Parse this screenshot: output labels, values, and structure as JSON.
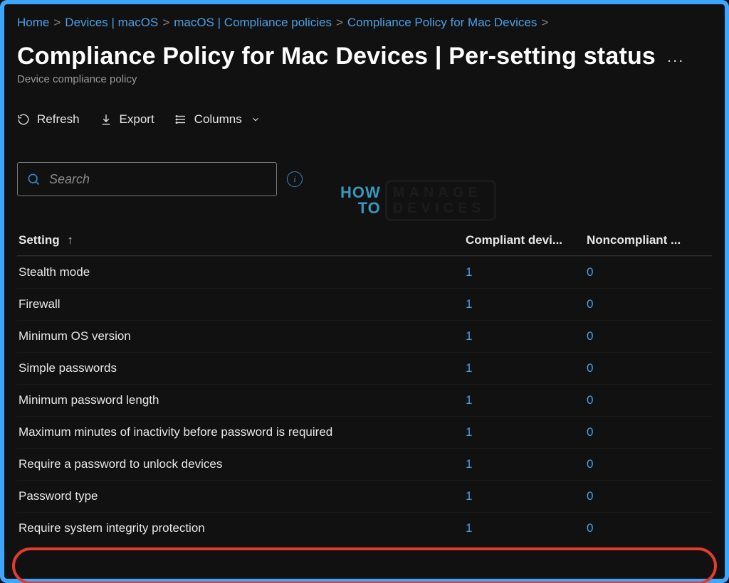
{
  "breadcrumb": {
    "items": [
      {
        "label": "Home"
      },
      {
        "label": "Devices | macOS"
      },
      {
        "label": "macOS | Compliance policies"
      },
      {
        "label": "Compliance Policy for Mac Devices"
      }
    ],
    "trailing_separator": ">"
  },
  "header": {
    "title": "Compliance Policy for Mac Devices | Per-setting status",
    "more_label": "...",
    "subtitle": "Device compliance policy"
  },
  "toolbar": {
    "refresh_label": "Refresh",
    "export_label": "Export",
    "columns_label": "Columns"
  },
  "search": {
    "placeholder": "Search",
    "info_glyph": "i"
  },
  "watermark": {
    "left_top": "HOW",
    "left_bottom": "TO",
    "right_top": "MANAGE",
    "right_bottom": "DEVICES"
  },
  "table": {
    "headers": {
      "setting": "Setting",
      "sort_glyph": "↑",
      "compliant": "Compliant devi...",
      "noncompliant": "Noncompliant ..."
    },
    "rows": [
      {
        "setting": "Stealth mode",
        "compliant": "1",
        "noncompliant": "0"
      },
      {
        "setting": "Firewall",
        "compliant": "1",
        "noncompliant": "0"
      },
      {
        "setting": "Minimum OS version",
        "compliant": "1",
        "noncompliant": "0"
      },
      {
        "setting": "Simple passwords",
        "compliant": "1",
        "noncompliant": "0"
      },
      {
        "setting": "Minimum password length",
        "compliant": "1",
        "noncompliant": "0"
      },
      {
        "setting": "Maximum minutes of inactivity before password is required",
        "compliant": "1",
        "noncompliant": "0"
      },
      {
        "setting": "Require a password to unlock devices",
        "compliant": "1",
        "noncompliant": "0"
      },
      {
        "setting": "Password type",
        "compliant": "1",
        "noncompliant": "0"
      },
      {
        "setting": "Require system integrity protection",
        "compliant": "1",
        "noncompliant": "0"
      }
    ],
    "highlight_row_index": 8
  }
}
